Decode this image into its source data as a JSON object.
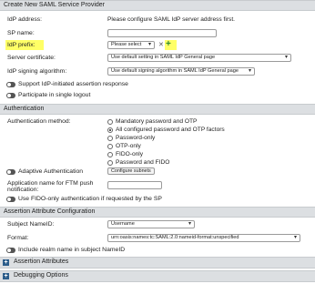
{
  "header": {
    "title": "Create New SAML Service Provider"
  },
  "fields": {
    "idp_address": {
      "label": "IdP address:",
      "value": "Please configure SAML IdP server address first."
    },
    "sp_name": {
      "label": "SP name:",
      "value": ""
    },
    "idp_prefix": {
      "label": "IdP prefix:",
      "select_value": "Please select",
      "clear_symbol": "✕",
      "add_symbol": "+"
    },
    "server_certificate": {
      "label": "Server certificate:",
      "value": "Use default setting in SAML IdP General page"
    },
    "idp_signing_algorithm": {
      "label": "IdP signing algorithm:",
      "value": "Use default signing algorithm in SAML IdP General page"
    },
    "support_idp_initiated": {
      "label": "Support IdP-initiated assertion response"
    },
    "participate_logout": {
      "label": "Participate in single logout"
    }
  },
  "authentication": {
    "section_title": "Authentication",
    "method_label": "Authentication method:",
    "methods": [
      {
        "label": "Mandatory password and OTP",
        "selected": false
      },
      {
        "label": "All configured password and OTP factors",
        "selected": true
      },
      {
        "label": "Password-only",
        "selected": false
      },
      {
        "label": "OTP-only",
        "selected": false
      },
      {
        "label": "FIDO-only",
        "selected": false
      },
      {
        "label": "Password and FIDO",
        "selected": false
      }
    ],
    "adaptive_label": "Adaptive Authentication",
    "configure_subnets_label": "Configure subnets",
    "ftm_push_label_line1": "Application name for FTM push",
    "ftm_push_label_line2": "notification:",
    "fido_only_label": "Use FIDO-only authentication if requested by the SP"
  },
  "assertion": {
    "section_title": "Assertion Attribute Configuration",
    "subject_nameid_label": "Subject NameID:",
    "subject_nameid_value": "Username",
    "format_label": "Format:",
    "format_value": "urn:oasis:names:tc:SAML:2.0:nameid-format:unspecified",
    "include_realm_label": "Include realm name in subject NameID"
  },
  "collapsed_sections": {
    "assertion_attributes": "Assertion Attributes",
    "debugging_options": "Debugging Options"
  },
  "colors": {
    "section_bg": "#dcdfe2",
    "highlight": "#ffff66",
    "accent": "#2c5d8a"
  }
}
